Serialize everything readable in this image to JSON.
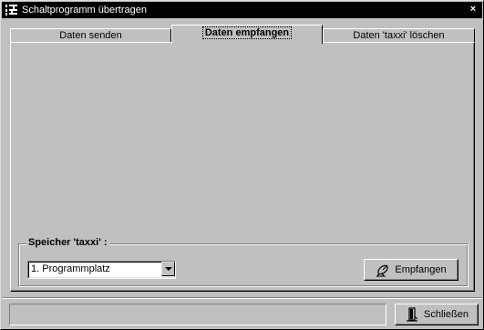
{
  "window": {
    "title": "Schaltprogramm übertragen",
    "close_glyph": "×",
    "icon": "app-icon"
  },
  "tabs": [
    {
      "label": "Daten senden",
      "active": false
    },
    {
      "label": "Daten empfangen",
      "active": true
    },
    {
      "label": "Daten 'taxxi' löschen",
      "active": false
    }
  ],
  "memory_group": {
    "label": "Speicher 'taxxi' :",
    "select": {
      "value": "1. Programmplatz"
    },
    "receive_button": {
      "label": "Empfangen",
      "icon": "satellite-dish-icon"
    }
  },
  "footer": {
    "close_button": {
      "label": "Schließen",
      "icon": "door-exit-icon"
    }
  }
}
